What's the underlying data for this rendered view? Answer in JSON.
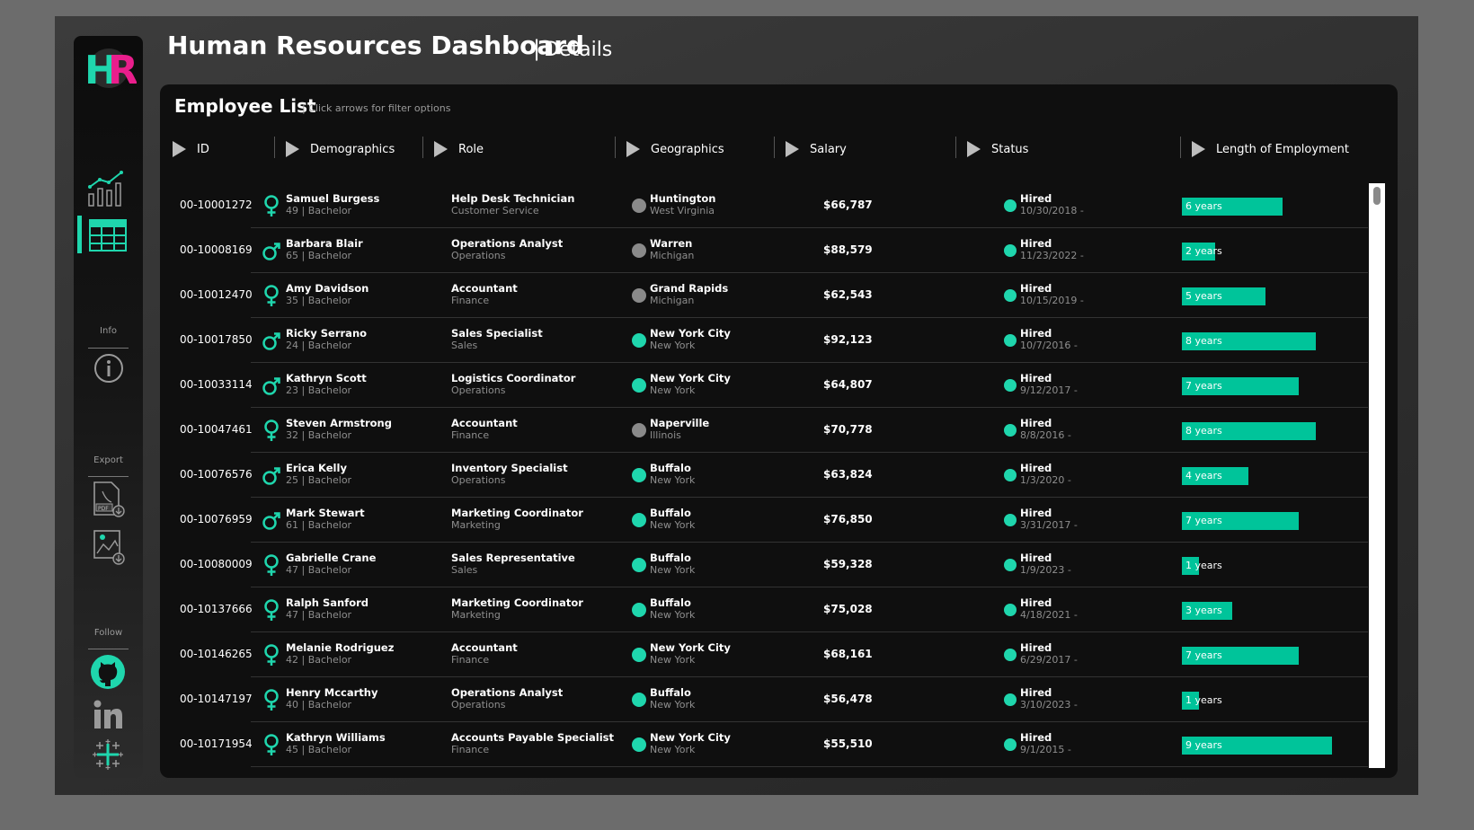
{
  "app": {
    "logo_text_h": "H",
    "logo_text_r": "R",
    "title": "Human Resources Dashboard",
    "title_separator": "|",
    "subtitle": "Details"
  },
  "sidebar": {
    "info_label": "Info",
    "export_label": "Export",
    "follow_label": "Follow",
    "pdf_icon_text": "PDF"
  },
  "panel": {
    "title": "Employee List",
    "hint": "| Click arrows for filter options"
  },
  "columns": {
    "id": "ID",
    "demographics": "Demographics",
    "role": "Role",
    "geographics": "Geographics",
    "salary": "Salary",
    "status": "Status",
    "length": "Length of Employment"
  },
  "colors": {
    "accent": "#1fd6ad",
    "bar": "#00c49a",
    "logo_h": "#1fd6ad",
    "logo_r": "#e91e8c",
    "geo_grey": "#8a8a8a"
  },
  "employees": [
    {
      "id": "00-10001272",
      "gender": "female",
      "name": "Samuel Burgess",
      "sub": "49 | Bachelor",
      "role": "Help Desk Technician",
      "dept": "Customer Service",
      "geo": "grey",
      "city": "Huntington",
      "state": "West Virginia",
      "salary": "$66,787",
      "status": "Hired",
      "date": "10/30/2018 -",
      "years": 6,
      "years_label": "6 years"
    },
    {
      "id": "00-10008169",
      "gender": "male",
      "name": "Barbara Blair",
      "sub": "65 | Bachelor",
      "role": "Operations Analyst",
      "dept": "Operations",
      "geo": "grey",
      "city": "Warren",
      "state": "Michigan",
      "salary": "$88,579",
      "status": "Hired",
      "date": "11/23/2022 -",
      "years": 2,
      "years_label": "2 years"
    },
    {
      "id": "00-10012470",
      "gender": "female",
      "name": "Amy Davidson",
      "sub": "35 | Bachelor",
      "role": "Accountant",
      "dept": "Finance",
      "geo": "grey",
      "city": "Grand Rapids",
      "state": "Michigan",
      "salary": "$62,543",
      "status": "Hired",
      "date": "10/15/2019 -",
      "years": 5,
      "years_label": "5 years"
    },
    {
      "id": "00-10017850",
      "gender": "male",
      "name": "Ricky Serrano",
      "sub": "24 | Bachelor",
      "role": "Sales Specialist",
      "dept": "Sales",
      "geo": "teal",
      "city": "New York City",
      "state": "New York",
      "salary": "$92,123",
      "status": "Hired",
      "date": "10/7/2016 -",
      "years": 8,
      "years_label": "8 years"
    },
    {
      "id": "00-10033114",
      "gender": "male",
      "name": "Kathryn Scott",
      "sub": "23 | Bachelor",
      "role": "Logistics Coordinator",
      "dept": "Operations",
      "geo": "teal",
      "city": "New York City",
      "state": "New York",
      "salary": "$64,807",
      "status": "Hired",
      "date": "9/12/2017 -",
      "years": 7,
      "years_label": "7 years"
    },
    {
      "id": "00-10047461",
      "gender": "female",
      "name": "Steven Armstrong",
      "sub": "32 | Bachelor",
      "role": "Accountant",
      "dept": "Finance",
      "geo": "grey",
      "city": "Naperville",
      "state": "Illinois",
      "salary": "$70,778",
      "status": "Hired",
      "date": "8/8/2016 -",
      "years": 8,
      "years_label": "8 years"
    },
    {
      "id": "00-10076576",
      "gender": "male",
      "name": "Erica Kelly",
      "sub": "25 | Bachelor",
      "role": "Inventory Specialist",
      "dept": "Operations",
      "geo": "teal",
      "city": "Buffalo",
      "state": "New York",
      "salary": "$63,824",
      "status": "Hired",
      "date": "1/3/2020 -",
      "years": 4,
      "years_label": "4 years"
    },
    {
      "id": "00-10076959",
      "gender": "male",
      "name": "Mark Stewart",
      "sub": "61 | Bachelor",
      "role": "Marketing Coordinator",
      "dept": "Marketing",
      "geo": "teal",
      "city": "Buffalo",
      "state": "New York",
      "salary": "$76,850",
      "status": "Hired",
      "date": "3/31/2017 -",
      "years": 7,
      "years_label": "7 years"
    },
    {
      "id": "00-10080009",
      "gender": "female",
      "name": "Gabrielle Crane",
      "sub": "47 | Bachelor",
      "role": "Sales Representative",
      "dept": "Sales",
      "geo": "teal",
      "city": "Buffalo",
      "state": "New York",
      "salary": "$59,328",
      "status": "Hired",
      "date": "1/9/2023 -",
      "years": 1,
      "years_label": "1 years"
    },
    {
      "id": "00-10137666",
      "gender": "female",
      "name": "Ralph Sanford",
      "sub": "47 | Bachelor",
      "role": "Marketing Coordinator",
      "dept": "Marketing",
      "geo": "teal",
      "city": "Buffalo",
      "state": "New York",
      "salary": "$75,028",
      "status": "Hired",
      "date": "4/18/2021 -",
      "years": 3,
      "years_label": "3 years"
    },
    {
      "id": "00-10146265",
      "gender": "female",
      "name": "Melanie Rodriguez",
      "sub": "42 | Bachelor",
      "role": "Accountant",
      "dept": "Finance",
      "geo": "teal",
      "city": "New York City",
      "state": "New York",
      "salary": "$68,161",
      "status": "Hired",
      "date": "6/29/2017 -",
      "years": 7,
      "years_label": "7 years"
    },
    {
      "id": "00-10147197",
      "gender": "female",
      "name": "Henry Mccarthy",
      "sub": "40 | Bachelor",
      "role": "Operations Analyst",
      "dept": "Operations",
      "geo": "teal",
      "city": "Buffalo",
      "state": "New York",
      "salary": "$56,478",
      "status": "Hired",
      "date": "3/10/2023 -",
      "years": 1,
      "years_label": "1 years"
    },
    {
      "id": "00-10171954",
      "gender": "female",
      "name": "Kathryn Williams",
      "sub": "45 | Bachelor",
      "role": "Accounts Payable Specialist",
      "dept": "Finance",
      "geo": "teal",
      "city": "New York City",
      "state": "New York",
      "salary": "$55,510",
      "status": "Hired",
      "date": "9/1/2015 -",
      "years": 9,
      "years_label": "9 years"
    }
  ]
}
